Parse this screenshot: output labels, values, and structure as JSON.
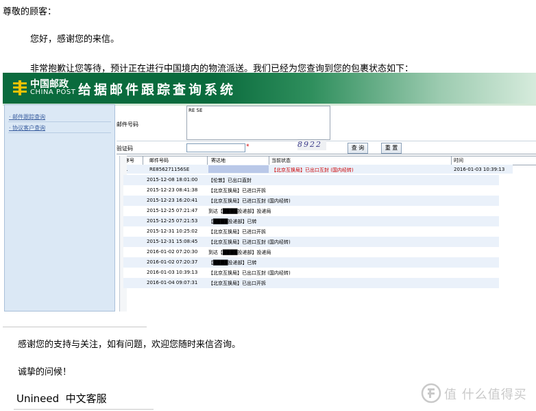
{
  "letter": {
    "greeting": "尊敬的顾客：",
    "hello": "您好，感谢您的来信。",
    "apology": "非常抱歉让您等待，预计正在进行中国境内的物流派送。我们已经为您查询到您的包裹状态如下：",
    "thanks": "感谢您的支持与关注，如有问题，欢迎您随时来信咨询。",
    "regards": "诚挚的问候！",
    "signature": "Unineed  中文客服"
  },
  "screenshot": {
    "logo_cn": "中国邮政",
    "logo_en": "CHINA POST",
    "site_title": "给据邮件跟踪查询系统",
    "sidebar_links": [
      "· 邮件跟踪查询",
      "· 协议客户查询"
    ],
    "mail_no_label": "邮件号码",
    "mail_no_value": "RE                    SE",
    "captcha_label": "验证码",
    "captcha_required": "*",
    "captcha_text": "8922",
    "query_button": "查 询",
    "reset_button": "重 置",
    "table_headers": [
      "序号",
      "邮件号码",
      "寄达地",
      "当前状态",
      "时间"
    ],
    "summary_row": {
      "index": "1",
      "mail_no": "RE856271156SE",
      "destination": "",
      "status": "【北京互换局】已出口互封 (国内经转)",
      "time": "2016-01-03 10:39:13"
    },
    "tracking": [
      {
        "time": "2015-12-08 18:01:00",
        "event": "【伦敦】已出口直封"
      },
      {
        "time": "2015-12-23 08:41:38",
        "event": "【北京互换局】已进口开拆"
      },
      {
        "time": "2015-12-23 16:20:41",
        "event": "【北京互换局】已进口互封 (国内经转)"
      },
      {
        "time": "2015-12-25 07:21:47",
        "event": "到达【████投递部】投递局"
      },
      {
        "time": "2015-12-25 07:21:53",
        "event": "【████投递部】已转"
      },
      {
        "time": "2015-12-31 10:25:02",
        "event": "【北京互换局】已进口开拆"
      },
      {
        "time": "2015-12-31 15:08:45",
        "event": "【北京互换局】已进口互封 (国内经转)"
      },
      {
        "time": "2016-01-02 07:20:30",
        "event": "到达【████投递部】投递局"
      },
      {
        "time": "2016-01-02 07:20:37",
        "event": "【████投递部】已转"
      },
      {
        "time": "2016-01-03 10:39:13",
        "event": "【北京互换局】已出口互封 (国内经转)"
      },
      {
        "time": "2016-01-04 09:07:31",
        "event": "【北京互换局】已出口开拆"
      }
    ],
    "colors": {
      "banner_green": "#0a6b3d",
      "status_red": "#cc0000",
      "row_alt": "#eaf1fa"
    }
  },
  "watermark": {
    "text": "值 什么值得买"
  }
}
